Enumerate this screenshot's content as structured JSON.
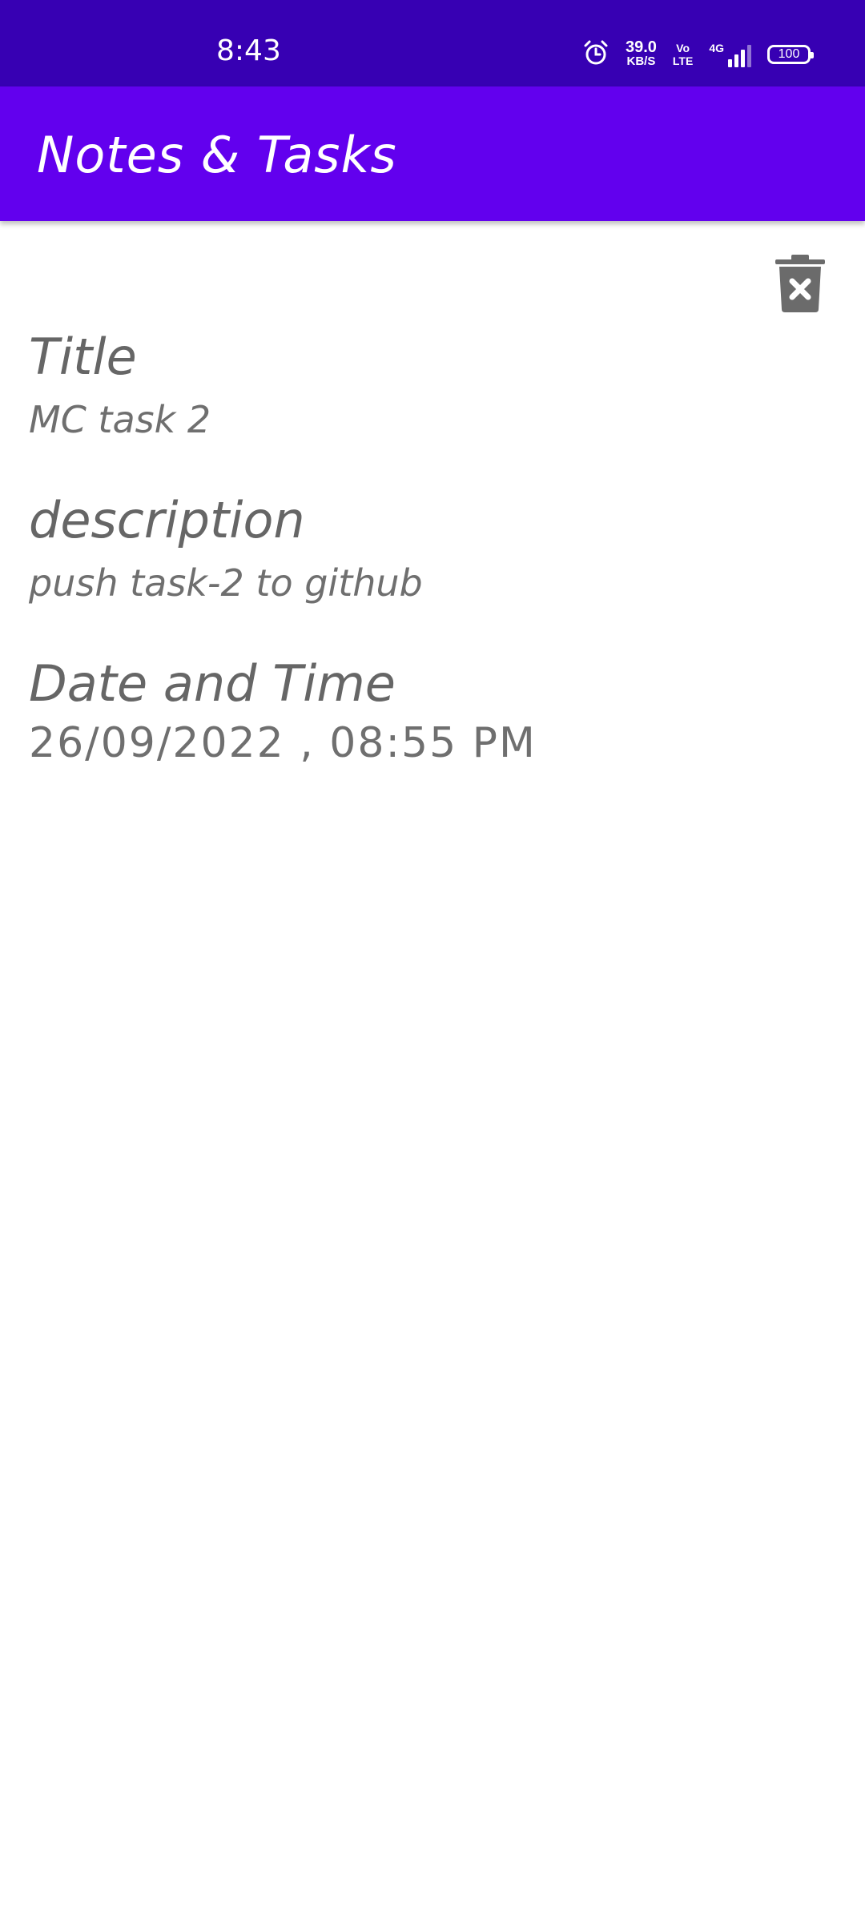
{
  "status_bar": {
    "time": "8:43",
    "net_speed_value": "39.0",
    "net_speed_unit": "KB/S",
    "volte_top": "Vo",
    "volte_bottom": "LTE",
    "network": "4G",
    "battery": "100",
    "background_color": "#3700b3"
  },
  "app_bar": {
    "title": "Notes & Tasks",
    "background_color": "#6200ee"
  },
  "note": {
    "title_label": "Title",
    "title_value": "MC task 2",
    "description_label": "description",
    "description_value": "push task-2 to github",
    "datetime_label": "Date and Time",
    "datetime_value": "26/09/2022 , 08:55 PM"
  },
  "icons": {
    "alarm": "alarm-icon",
    "delete": "delete-icon"
  }
}
